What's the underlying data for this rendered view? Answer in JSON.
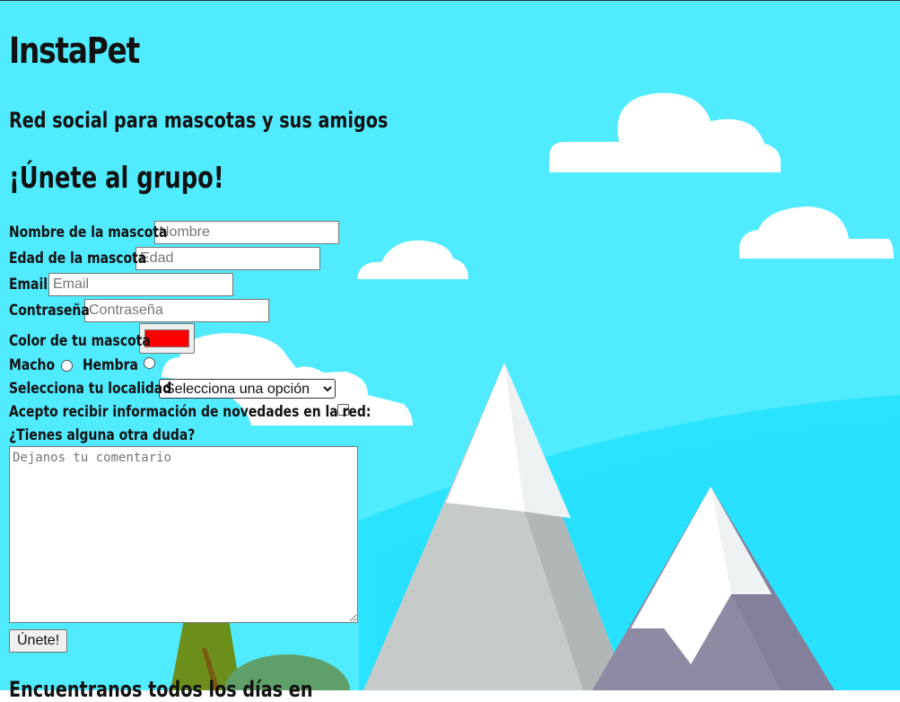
{
  "header": {
    "title": "InstaPet",
    "subtitle": "Red social para mascotas y sus amigos"
  },
  "form": {
    "heading": "¡Únete al grupo!",
    "name_label": "Nombre de la mascota",
    "name_placeholder": "Nombre",
    "age_label": "Edad de la mascota",
    "age_placeholder": "Edad",
    "email_label": "Email",
    "email_placeholder": "Email",
    "password_label": "Contraseña",
    "password_placeholder": "Contraseña",
    "color_label": "Color de tu mascota",
    "color_value": "#ff0000",
    "male_label": "Macho",
    "female_label": "Hembra",
    "location_label": "Selecciona tu localidad",
    "location_selected": "Selecciona una opción",
    "newsletter_label": "Acepto recibir información de novedades en la red:",
    "question_label": "¿Tienes alguna otra duda?",
    "comment_placeholder": "Dejanos tu comentario",
    "submit_label": "Únete!"
  },
  "footer": {
    "partial_heading": "Encuentranos todos los días en"
  },
  "colors": {
    "sky": "#50ebff",
    "hill": "#2ae0ff",
    "cloud": "#ffffff",
    "mountain_gray": "#c5c9c9",
    "mountain_purple": "#8e8aa3"
  }
}
